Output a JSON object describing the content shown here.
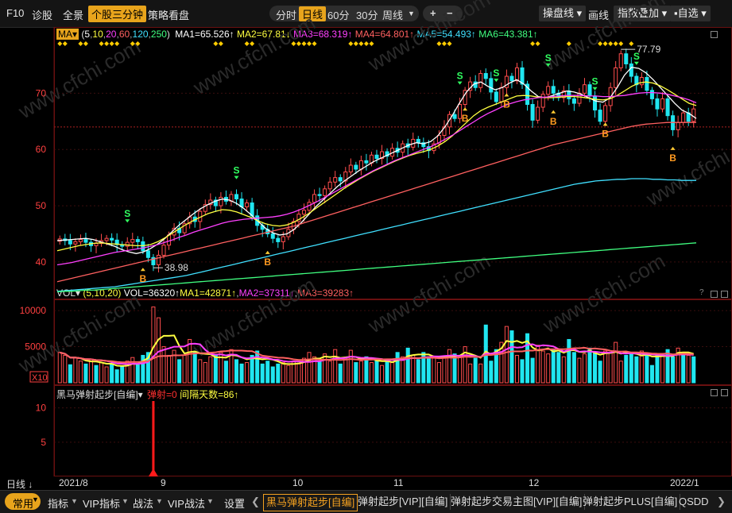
{
  "toolbar": {
    "left_items": [
      "F10",
      "诊股",
      "全景",
      "个股三分钟",
      "策略看盘"
    ],
    "active_left": "个股三分钟",
    "periods": [
      "分时",
      "日线",
      "60分",
      "30分",
      "周线"
    ],
    "active_period": "日线",
    "zoom_in": "+",
    "zoom_out": "−",
    "right_items": [
      "操盘线",
      "画线",
      "指数叠加",
      "自选"
    ]
  },
  "main_panel": {
    "indicator": "MA",
    "params_open": "(",
    "params": [
      "5",
      "10",
      "20",
      "60",
      "120",
      "250"
    ],
    "params_close": ")",
    "ma_labels": [
      "MA1=65.526↑",
      "MA2=67.81↓",
      "MA3=68.319↑",
      "MA4=64.801↑",
      "MA5=54.493↑",
      "MA6=43.381↑"
    ],
    "ma_colors": [
      "#ffffff",
      "#ffff40",
      "#ff40ff",
      "#ff6060",
      "#40e0ff",
      "#40ff80"
    ],
    "high_label": "77.79",
    "low_label": "38.98",
    "signal_buy": "B",
    "signal_sell": "S"
  },
  "volume_panel": {
    "indicator": "VOL",
    "params": "(5,10,20)",
    "labels": [
      "VOL=36320↑",
      "MA1=42871↑",
      "MA2=37311↑",
      "MA3=39283↑"
    ],
    "label_colors": [
      "#ffffff",
      "#ffff40",
      "#ff40ff",
      "#ff6060"
    ],
    "unit": "X10"
  },
  "signal_panel": {
    "name": "黑马弹射起步[自编]",
    "labels": [
      "弹射=0",
      "间隔天数=86↑"
    ],
    "label_colors": [
      "#ff3030",
      "#ffff40"
    ]
  },
  "date_axis": {
    "period_label": "日线",
    "ticks": [
      "2021/8",
      "9",
      "10",
      "11",
      "12",
      "2022/1"
    ]
  },
  "bottombar": {
    "left_items": [
      "常用",
      "指标",
      "VIP指标",
      "战法",
      "VIP战法",
      "设置"
    ],
    "tabs": [
      "黑马弹射起步[自编]",
      "弹射起步[VIP][自编]",
      "弹射起步交易主图[VIP][自编]",
      "弹射起步PLUS[自编]",
      "QSDD"
    ],
    "active_tab": "黑马弹射起步[自编]"
  },
  "watermark": "www.cfchi.com",
  "chart_data": [
    {
      "type": "candlestick",
      "x_ticks": [
        "2021/8",
        "9",
        "10",
        "11",
        "12",
        "2022/1"
      ],
      "y_ticks": [
        40,
        50,
        60,
        70
      ],
      "ylim": [
        33.5,
        79.5
      ],
      "high_marker": 77.79,
      "low_marker": 38.98,
      "closes": [
        44.1,
        43.8,
        43.2,
        43.6,
        44.0,
        43.5,
        42.9,
        43.3,
        43.8,
        44.2,
        43.9,
        43.1,
        42.8,
        43.5,
        44.0,
        43.6,
        42.0,
        40.8,
        39.5,
        41.2,
        43.0,
        44.8,
        46.0,
        45.2,
        46.8,
        48.0,
        47.2,
        49.0,
        50.2,
        51.0,
        50.0,
        51.5,
        50.8,
        52.0,
        51.2,
        49.8,
        50.5,
        48.2,
        46.5,
        45.8,
        45.0,
        44.2,
        43.6,
        44.5,
        45.8,
        47.2,
        48.5,
        49.2,
        50.6,
        52.0,
        51.8,
        53.0,
        54.2,
        55.0,
        54.4,
        56.0,
        57.2,
        56.5,
        58.0,
        57.6,
        59.0,
        58.4,
        59.6,
        58.8,
        60.2,
        59.5,
        61.0,
        60.4,
        61.8,
        61.2,
        60.5,
        59.8,
        61.0,
        62.5,
        64.0,
        66.2,
        65.5,
        68.0,
        70.5,
        72.0,
        71.0,
        73.5,
        72.6,
        70.2,
        68.5,
        71.0,
        73.0,
        72.2,
        74.5,
        71.6,
        68.0,
        65.2,
        67.5,
        69.8,
        71.2,
        70.0,
        69.2,
        70.4,
        69.0,
        68.2,
        70.0,
        71.5,
        69.5,
        67.0,
        65.0,
        67.8,
        71.0,
        74.5,
        77.0,
        75.2,
        73.0,
        71.5,
        72.8,
        70.5,
        69.0,
        67.2,
        69.0,
        66.0,
        63.5,
        64.8,
        66.5,
        65.0,
        67.2
      ],
      "ma_lines": {
        "MA1": [
          43.8,
          43.9,
          44.0,
          44.1,
          44.2,
          44.0,
          43.6,
          43.2,
          42.8,
          42.2,
          41.8,
          41.5,
          41.8,
          42.4,
          43.2,
          44.2,
          45.4,
          46.6,
          47.6,
          48.6,
          49.5,
          50.2,
          50.8,
          51.2,
          51.0,
          50.4,
          49.5,
          48.4,
          47.2,
          46.0,
          45.2,
          44.8,
          45.0,
          45.8,
          47.0,
          48.4,
          49.8,
          51.0,
          52.2,
          53.4,
          54.4,
          55.3,
          56.2,
          57.0,
          57.8,
          58.4,
          59.0,
          59.6,
          60.2,
          60.8,
          61.2,
          61.0,
          61.4,
          62.4,
          64.0,
          66.0,
          68.2,
          70.2,
          71.6,
          72.0,
          71.2,
          70.6,
          71.0,
          71.8,
          72.4,
          71.6,
          70.4,
          69.4,
          69.2,
          69.6,
          70.0,
          70.4,
          70.2,
          69.8,
          69.2,
          68.6,
          68.4,
          69.2,
          71.0,
          73.2,
          74.6,
          74.4,
          73.6,
          72.4,
          71.0,
          69.6,
          68.2,
          67.0,
          66.4,
          65.5
        ],
        "MA2": [
          42.0,
          42.3,
          42.6,
          42.9,
          43.1,
          43.3,
          43.4,
          43.3,
          43.2,
          43.1,
          43.0,
          42.9,
          42.9,
          43.1,
          43.6,
          44.3,
          45.1,
          45.9,
          46.7,
          47.4,
          48.0,
          48.6,
          49.0,
          49.3,
          49.2,
          48.9,
          48.4,
          47.9,
          47.3,
          46.8,
          46.5,
          46.4,
          46.6,
          47.1,
          47.8,
          48.6,
          49.5,
          50.4,
          51.3,
          52.2,
          53.1,
          53.9,
          54.7,
          55.4,
          56.1,
          56.7,
          57.3,
          57.9,
          58.4,
          58.9,
          59.3,
          59.6,
          60.0,
          60.6,
          61.4,
          62.4,
          63.6,
          64.8,
          66.0,
          66.9,
          67.5,
          68.0,
          68.5,
          69.0,
          69.5,
          69.6,
          69.5,
          69.3,
          69.2,
          69.2,
          69.3,
          69.4,
          69.4,
          69.3,
          69.1,
          68.9,
          68.8,
          69.0,
          69.6,
          70.4,
          71.2,
          71.8,
          72.0,
          71.8,
          71.3,
          70.6,
          69.8,
          69.0,
          68.2,
          67.8
        ],
        "MA3": [
          39.5,
          39.7,
          39.9,
          40.2,
          40.5,
          40.8,
          41.1,
          41.4,
          41.7,
          41.9,
          42.1,
          42.3,
          42.5,
          42.8,
          43.1,
          43.5,
          43.9,
          44.4,
          44.8,
          45.3,
          45.7,
          46.1,
          46.5,
          46.9,
          47.2,
          47.4,
          47.6,
          47.7,
          47.8,
          47.9,
          48.0,
          48.2,
          48.5,
          48.9,
          49.4,
          50.0,
          50.6,
          51.3,
          52.0,
          52.7,
          53.4,
          54.1,
          54.8,
          55.5,
          56.2,
          56.8,
          57.4,
          58.0,
          58.5,
          59.0,
          59.5,
          60.0,
          60.5,
          61.1,
          61.8,
          62.5,
          63.3,
          64.1,
          64.9,
          65.7,
          66.4,
          67.0,
          67.6,
          68.1,
          68.5,
          68.8,
          69.0,
          69.2,
          69.3,
          69.4,
          69.5,
          69.6,
          69.6,
          69.6,
          69.5,
          69.5,
          69.4,
          69.4,
          69.5,
          69.6,
          69.8,
          70.0,
          70.1,
          70.1,
          70.0,
          69.8,
          69.5,
          69.2,
          68.8,
          68.3
        ],
        "MA4": [
          36.5,
          36.8,
          37.1,
          37.4,
          37.7,
          38.0,
          38.3,
          38.6,
          38.9,
          39.2,
          39.5,
          39.8,
          40.1,
          40.4,
          40.7,
          41.0,
          41.3,
          41.6,
          41.9,
          42.2,
          42.5,
          42.8,
          43.1,
          43.4,
          43.7,
          44.0,
          44.3,
          44.6,
          44.9,
          45.2,
          45.5,
          45.8,
          46.1,
          46.4,
          46.8,
          47.2,
          47.6,
          48.0,
          48.4,
          48.8,
          49.2,
          49.6,
          50.0,
          50.4,
          50.8,
          51.2,
          51.6,
          52.0,
          52.4,
          52.8,
          53.2,
          53.6,
          54.0,
          54.4,
          54.8,
          55.2,
          55.6,
          56.0,
          56.4,
          56.8,
          57.2,
          57.6,
          58.0,
          58.4,
          58.8,
          59.2,
          59.6,
          60.0,
          60.4,
          60.8,
          61.1,
          61.4,
          61.7,
          62.0,
          62.3,
          62.6,
          62.9,
          63.2,
          63.5,
          63.8,
          64.1,
          64.3,
          64.5,
          64.6,
          64.7,
          64.8,
          64.8,
          64.8,
          64.8,
          64.8
        ],
        "MA5": [
          34.8,
          34.9,
          35.0,
          35.1,
          35.2,
          35.3,
          35.4,
          35.5,
          35.6,
          35.8,
          36.0,
          36.2,
          36.4,
          36.6,
          36.8,
          37.0,
          37.2,
          37.4,
          37.6,
          37.9,
          38.2,
          38.5,
          38.8,
          39.1,
          39.4,
          39.7,
          40.0,
          40.3,
          40.6,
          40.9,
          41.2,
          41.5,
          41.8,
          42.1,
          42.4,
          42.7,
          43.0,
          43.3,
          43.6,
          43.9,
          44.2,
          44.5,
          44.8,
          45.1,
          45.4,
          45.7,
          46.0,
          46.3,
          46.6,
          46.9,
          47.2,
          47.5,
          47.8,
          48.1,
          48.4,
          48.7,
          49.0,
          49.3,
          49.6,
          49.9,
          50.2,
          50.5,
          50.8,
          51.1,
          51.4,
          51.7,
          52.0,
          52.3,
          52.6,
          52.9,
          53.2,
          53.5,
          53.8,
          54.0,
          54.2,
          54.4,
          54.5,
          54.6,
          54.7,
          54.7,
          54.8,
          54.8,
          54.8,
          54.7,
          54.7,
          54.6,
          54.6,
          54.5,
          54.5,
          54.5
        ],
        "MA6": [
          34.7,
          34.8,
          34.8,
          34.9,
          35.0,
          35.0,
          35.1,
          35.2,
          35.3,
          35.4,
          35.5,
          35.6,
          35.7,
          35.8,
          35.9,
          36.0,
          36.1,
          36.2,
          36.3,
          36.4,
          36.5,
          36.6,
          36.7,
          36.8,
          36.9,
          37.0,
          37.1,
          37.2,
          37.3,
          37.4,
          37.5,
          37.6,
          37.7,
          37.8,
          37.9,
          38.0,
          38.1,
          38.2,
          38.3,
          38.4,
          38.5,
          38.6,
          38.7,
          38.8,
          38.9,
          39.0,
          39.1,
          39.2,
          39.3,
          39.4,
          39.5,
          39.6,
          39.7,
          39.8,
          39.9,
          40.0,
          40.1,
          40.2,
          40.3,
          40.4,
          40.5,
          40.6,
          40.7,
          40.8,
          40.9,
          41.0,
          41.1,
          41.2,
          41.3,
          41.4,
          41.5,
          41.6,
          41.7,
          41.8,
          41.9,
          42.0,
          42.1,
          42.2,
          42.3,
          42.4,
          42.5,
          42.6,
          42.7,
          42.8,
          42.9,
          43.0,
          43.1,
          43.2,
          43.3,
          43.4
        ]
      }
    },
    {
      "type": "bar",
      "title": "VOL",
      "y_ticks": [
        5000,
        10000
      ],
      "ylim": [
        0,
        11000
      ],
      "values": [
        4200,
        3800,
        2500,
        3500,
        3000,
        2600,
        3200,
        2400,
        2800,
        2200,
        2600,
        1800,
        2200,
        3000,
        3500,
        2600,
        3800,
        4200,
        10500,
        9000,
        5000,
        3800,
        4500,
        3200,
        3800,
        6000,
        4200,
        3200,
        2800,
        3600,
        3800,
        4200,
        3000,
        4600,
        3200,
        2600,
        2800,
        3800,
        4400,
        2600,
        3000,
        2200,
        2600,
        2800,
        2400,
        3000,
        2600,
        3400,
        4200,
        3600,
        3000,
        4000,
        3000,
        4600,
        2600,
        3400,
        4500,
        2800,
        3000,
        3600,
        2800,
        3200,
        2400,
        3000,
        2800,
        4200,
        3600,
        4800,
        3800,
        3200,
        4200,
        3600,
        3400,
        2800,
        3600,
        4600,
        4000,
        3800,
        5000,
        2600,
        3400,
        2600,
        8000,
        3000,
        4600,
        5600,
        7800,
        7200,
        3800,
        3200,
        6800,
        3400,
        5200,
        4400,
        4000,
        4600,
        4200,
        3600,
        6000,
        4200,
        3400,
        4000,
        4800,
        4200,
        3000,
        4400,
        4200,
        5600,
        3000,
        3800,
        4000,
        3600,
        4400,
        3800,
        2400,
        4000,
        3800,
        4600,
        3600,
        4800,
        4200,
        3800,
        3600
      ],
      "up_flags": [
        1,
        1,
        0,
        1,
        1,
        0,
        1,
        0,
        1,
        1,
        0,
        0,
        0,
        1,
        1,
        0,
        0,
        0,
        1,
        1,
        1,
        1,
        1,
        0,
        1,
        1,
        0,
        1,
        1,
        1,
        0,
        1,
        0,
        1,
        0,
        0,
        1,
        0,
        0,
        0,
        0,
        0,
        0,
        1,
        1,
        1,
        1,
        1,
        1,
        1,
        0,
        1,
        1,
        1,
        0,
        1,
        1,
        0,
        1,
        0,
        1,
        0,
        1,
        0,
        1,
        0,
        1,
        0,
        1,
        0,
        0,
        0,
        1,
        1,
        1,
        1,
        0,
        1,
        1,
        1,
        0,
        1,
        0,
        0,
        0,
        1,
        1,
        0,
        1,
        0,
        0,
        0,
        1,
        1,
        1,
        0,
        0,
        1,
        0,
        0,
        1,
        1,
        0,
        0,
        0,
        1,
        1,
        1,
        1,
        0,
        0,
        0,
        1,
        0,
        0,
        0,
        1,
        0,
        0,
        1,
        0,
        1,
        0
      ]
    }
  ]
}
